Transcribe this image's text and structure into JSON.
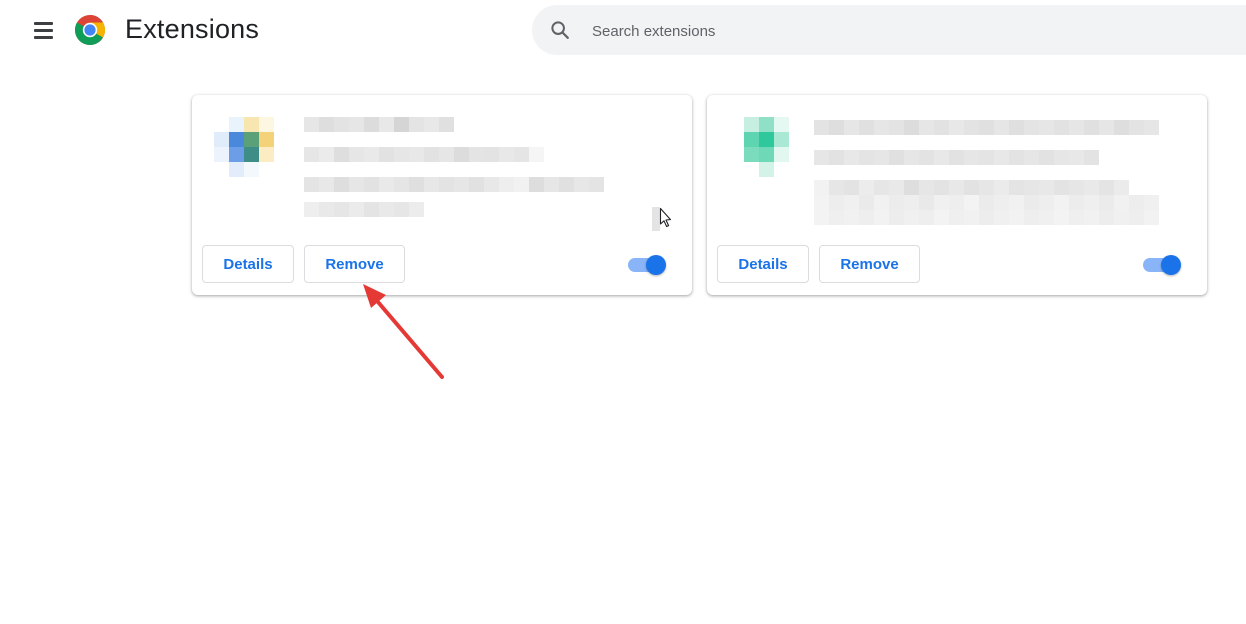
{
  "header": {
    "title": "Extensions",
    "menu_icon": "hamburger-menu-icon",
    "logo_icon": "chrome-logo-icon",
    "search": {
      "placeholder": "Search extensions",
      "value": "",
      "icon": "search-icon"
    }
  },
  "extensions": [
    {
      "details_label": "Details",
      "remove_label": "Remove",
      "enabled": true
    },
    {
      "details_label": "Details",
      "remove_label": "Remove",
      "enabled": true
    }
  ],
  "colors": {
    "accent": "#1a73e8",
    "toggle_track": "#8ab4f8",
    "annotation_arrow": "#e53935",
    "search_bg": "#f1f3f4"
  }
}
